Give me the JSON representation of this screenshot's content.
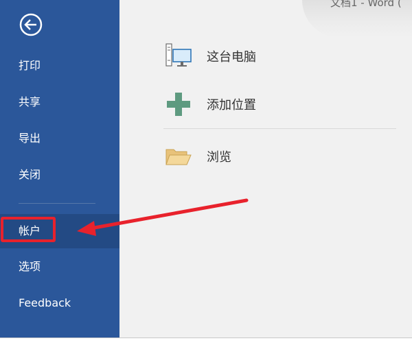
{
  "titlebar": {
    "text": "文档1 - Word ("
  },
  "sidebar": {
    "back_icon": "back-arrow-icon",
    "items": [
      {
        "label": "打印"
      },
      {
        "label": "共享"
      },
      {
        "label": "导出"
      },
      {
        "label": "关闭"
      },
      {
        "label": "帐户",
        "selected": true
      },
      {
        "label": "选项"
      },
      {
        "label": "Feedback"
      }
    ]
  },
  "locations": [
    {
      "label": "这台电脑",
      "icon": "computer-icon"
    },
    {
      "label": "添加位置",
      "icon": "plus-icon"
    },
    {
      "label": "浏览",
      "icon": "folder-icon"
    }
  ],
  "colors": {
    "sidebar_bg": "#2b579a",
    "sidebar_selected": "#234a84",
    "annotation_red": "#e8222c",
    "content_bg": "#f1f1f1"
  }
}
